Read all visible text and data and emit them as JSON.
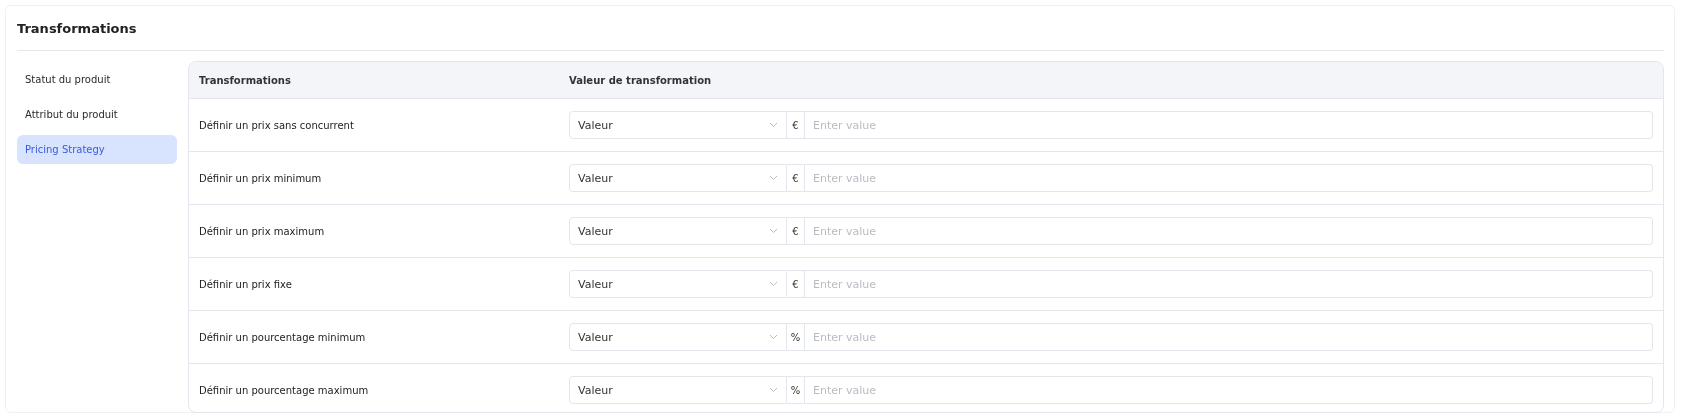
{
  "title": "Transformations",
  "sidebar": {
    "items": [
      {
        "label": "Statut du produit",
        "selected": false
      },
      {
        "label": "Attribut du produit",
        "selected": false
      },
      {
        "label": "Pricing Strategy",
        "selected": true
      }
    ]
  },
  "table": {
    "columns": [
      "Transformations",
      "Valeur de transformation"
    ],
    "rows": [
      {
        "name": "Définir un prix sans concurrent",
        "select": "Valeur",
        "unit": "€",
        "placeholder": "Enter value"
      },
      {
        "name": "Définir un prix minimum",
        "select": "Valeur",
        "unit": "€",
        "placeholder": "Enter value"
      },
      {
        "name": "Définir un prix maximum",
        "select": "Valeur",
        "unit": "€",
        "placeholder": "Enter value"
      },
      {
        "name": "Définir un prix fixe",
        "select": "Valeur",
        "unit": "€",
        "placeholder": "Enter value"
      },
      {
        "name": "Définir un pourcentage minimum",
        "select": "Valeur",
        "unit": "%",
        "placeholder": "Enter value"
      },
      {
        "name": "Définir un pourcentage maximum",
        "select": "Valeur",
        "unit": "%",
        "placeholder": "Enter value"
      }
    ]
  }
}
